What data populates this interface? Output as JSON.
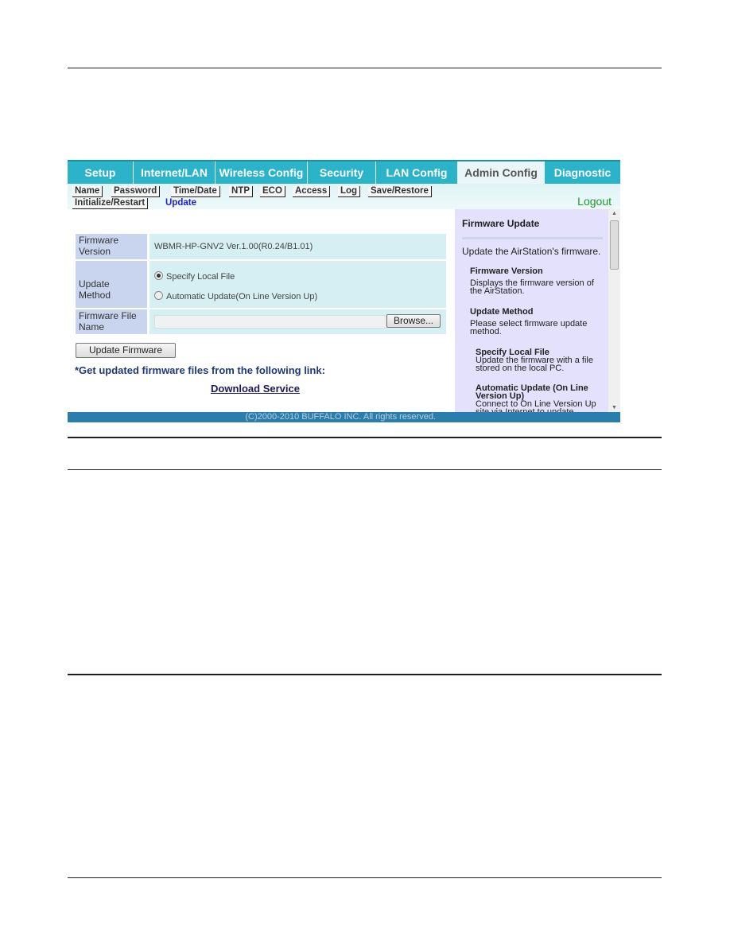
{
  "tabs": [
    "Setup",
    "Internet/LAN",
    "Wireless Config",
    "Security",
    "LAN Config",
    "Admin Config",
    "Diagnostic"
  ],
  "active_tab": "Admin Config",
  "subnav": [
    "Name",
    "Password",
    "Time/Date",
    "NTP",
    "ECO",
    "Access",
    "Log",
    "Save/Restore",
    "Initialize/Restart",
    "Update"
  ],
  "current_subnav": "Update",
  "logout": "Logout",
  "form": {
    "firmware_version_label": "Firmware Version",
    "firmware_version_value": "WBMR-HP-GNV2 Ver.1.00(R0.24/B1.01)",
    "update_method_label": "Update Method",
    "option_local": "Specify Local File",
    "option_auto": "Automatic Update(On Line Version Up)",
    "selected_option": "Specify Local File",
    "file_name_label": "Firmware File Name",
    "file_name_value": "",
    "browse": "Browse...",
    "update_button": "Update Firmware",
    "link_note": "*Get updated firmware files from the following link:",
    "download_link": "Download Service"
  },
  "help": {
    "title": "Firmware Update",
    "intro": "Update the AirStation's firmware.",
    "h1": "Firmware Version",
    "t1": "Displays the firmware version of the AirStation.",
    "h2": "Update Method",
    "t2": "Please select firmware update method.",
    "h3": "Specify Local File",
    "t3": "Update the firmware with a file stored on the local PC.",
    "h4": "Automatic Update (On Line Version Up)",
    "t4": "Connect to On Line Version Up site via Internet to update"
  },
  "footer": "(C)2000-2010 BUFFALO INC. All rights reserved.",
  "colors": {
    "tab_bar": "#2bb3c9",
    "label_cell": "#c9d5ef",
    "value_cell": "#d5eff3",
    "help_bg": "#e3e1fb",
    "footer": "#2a7eae",
    "logout": "#1a9a2a",
    "current_subnav": "#2222cc"
  }
}
